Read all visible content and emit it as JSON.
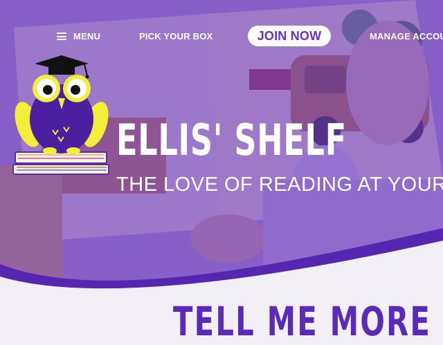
{
  "nav": {
    "menu_label": "MENU",
    "pick_label": "PICK YOUR BOX",
    "join_label": "JOIN NOW",
    "manage_label": "MANAGE ACCOU"
  },
  "hero": {
    "title": "ELLIS' SHELF",
    "tagline": "THE LOVE OF READING AT YOUR"
  },
  "section": {
    "heading": "TELL ME MORE"
  },
  "colors": {
    "brand_purple": "#6a2fc4",
    "owl_yellow": "#f2ee3a",
    "heading_purple": "#5a2bb8"
  },
  "icons": [
    "hamburger-menu-icon",
    "owl-logo-icon",
    "graduation-cap-icon",
    "books-stack-icon"
  ]
}
